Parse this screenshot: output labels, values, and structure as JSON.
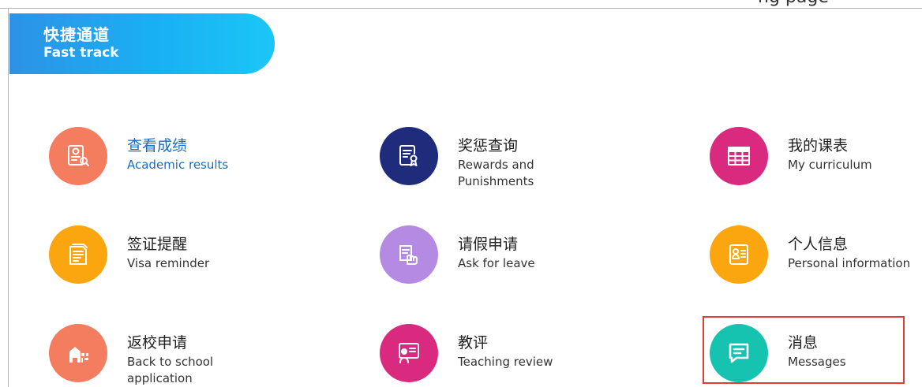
{
  "header": {
    "cutoff_text": "ng page",
    "title_cn": "快捷通道",
    "title_en": "Fast track"
  },
  "colors": {
    "banner": "#1fa9ef",
    "academic": "#f47c5f",
    "rewards": "#1f2c7c",
    "curriculum": "#da2a7f",
    "visa": "#fba60f",
    "leave": "#b58ae3",
    "personal": "#fba60f",
    "back_school": "#f47c5f",
    "teaching": "#da2a7f",
    "messages": "#16c3b1",
    "highlight": "#e03c3c"
  },
  "tiles": [
    {
      "name_cn": "查看成绩",
      "name_en": "Academic results",
      "icon": "report-search-icon",
      "link": true
    },
    {
      "name_cn": "奖惩查询",
      "name_en": "Rewards and Punishments",
      "icon": "certificate-icon",
      "link": false
    },
    {
      "name_cn": "我的课表",
      "name_en": "My curriculum",
      "icon": "timetable-icon",
      "link": false
    },
    {
      "name_cn": "签证提醒",
      "name_en": "Visa reminder",
      "icon": "visa-document-icon",
      "link": false
    },
    {
      "name_cn": "请假申请",
      "name_en": "Ask for leave",
      "icon": "hand-document-icon",
      "link": false
    },
    {
      "name_cn": "个人信息",
      "name_en": "Personal information",
      "icon": "id-card-icon",
      "link": false
    },
    {
      "name_cn": "返校申请",
      "name_en": "Back to school application",
      "icon": "school-building-icon",
      "link": false
    },
    {
      "name_cn": "教评",
      "name_en": "Teaching review",
      "icon": "teacher-review-icon",
      "link": false
    },
    {
      "name_cn": "消息",
      "name_en": "Messages",
      "icon": "message-icon",
      "link": false,
      "highlighted": true
    }
  ]
}
